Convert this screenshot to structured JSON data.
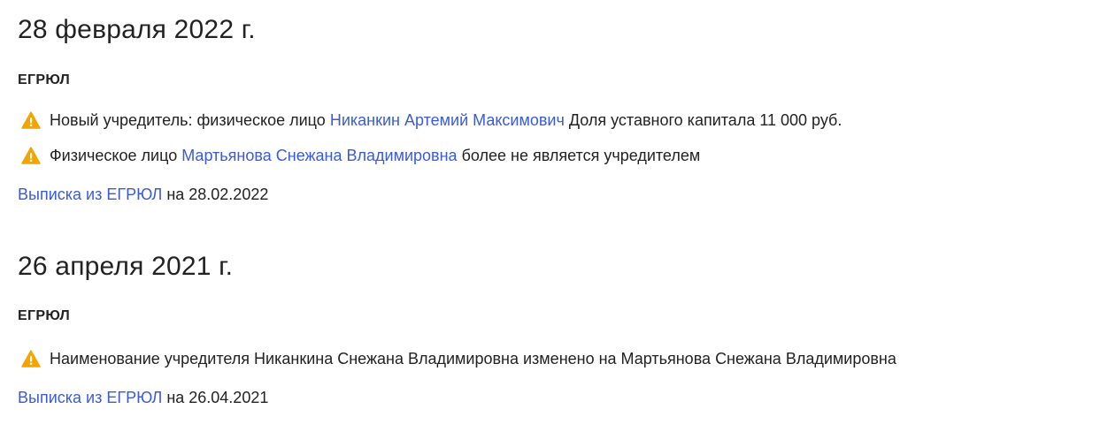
{
  "timeline": [
    {
      "date": "28 февраля 2022 г.",
      "source": "ЕГРЮЛ",
      "events": [
        {
          "icon": "warning-icon",
          "prefix": "Новый учредитель: физическое лицо",
          "link": "Никанкин Артемий Максимович",
          "suffix": "Доля уставного капитала 11 000 руб."
        },
        {
          "icon": "warning-icon",
          "prefix": "Физическое лицо",
          "link": "Мартьянова Снежана Владимировна",
          "suffix": "более не является учредителем"
        }
      ],
      "extract_link": "Выписка из ЕГРЮЛ",
      "extract_suffix": "на 28.02.2022"
    },
    {
      "date": "26 апреля 2021 г.",
      "source": "ЕГРЮЛ",
      "events": [
        {
          "icon": "warning-icon",
          "text": "Наименование учредителя Никанкина Снежана Владимировна изменено на Мартьянова Снежана Владимировна"
        }
      ],
      "extract_link": "Выписка из ЕГРЮЛ",
      "extract_suffix": "на 26.04.2021"
    }
  ],
  "colors": {
    "text": "#222222",
    "link": "#3a5bd9",
    "warning": "#f2a400"
  }
}
